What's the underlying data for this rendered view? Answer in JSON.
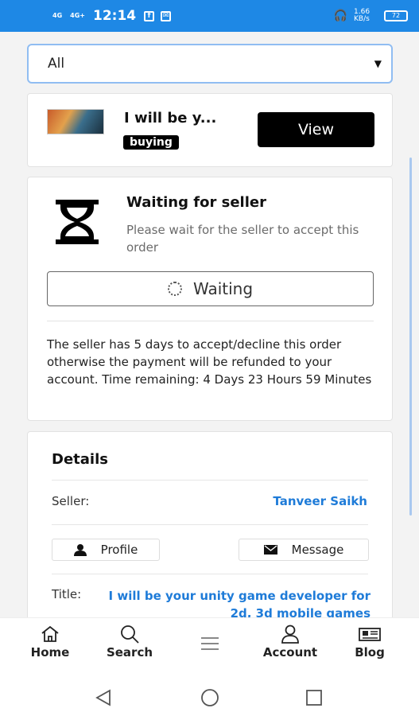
{
  "status_bar": {
    "signal_1": "4G",
    "signal_2": "4G+",
    "time": "12:14",
    "speed": "1.66 KB/s",
    "battery": "72"
  },
  "filter": {
    "selected": "All"
  },
  "gig": {
    "title": "I will be y...",
    "badge": "buying",
    "view_label": "View"
  },
  "waiting": {
    "title": "Waiting for seller",
    "subtitle": "Please wait for the seller to accept this order",
    "button_label": "Waiting",
    "note": "The seller has 5 days to accept/decline this order otherwise the payment will be refunded to your account. Time remaining: 4 Days 23 Hours 59 Minutes"
  },
  "details": {
    "title": "Details",
    "seller_label": "Seller:",
    "seller_name": "Tanveer Saikh",
    "profile_label": "Profile",
    "message_label": "Message",
    "title_label": "Title:",
    "title_value": "I will be your unity game developer for 2d, 3d mobile games"
  },
  "nav": {
    "items": [
      {
        "label": "Home",
        "icon": "home-icon"
      },
      {
        "label": "Search",
        "icon": "search-icon"
      },
      {
        "label": "",
        "icon": "menu-icon"
      },
      {
        "label": "Account",
        "icon": "account-icon"
      },
      {
        "label": "Blog",
        "icon": "newspaper-icon"
      }
    ]
  },
  "colors": {
    "status_bar": "#1e88e5",
    "link": "#1e7bd8",
    "button_dark": "#000000"
  }
}
